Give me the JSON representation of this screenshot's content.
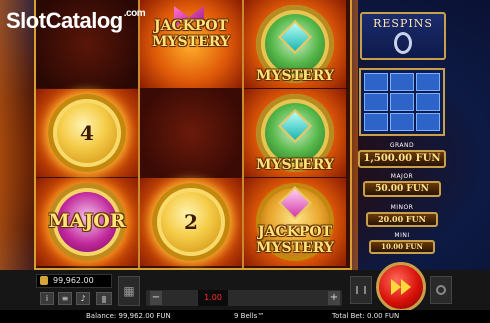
{
  "watermark": {
    "slot": "Slot",
    "catalog": "Catalog",
    "com": ".com"
  },
  "reels": {
    "r1c2": {
      "line1": "JACKPOT",
      "line2": "MYSTERY"
    },
    "r1c3": {
      "label": "MYSTERY"
    },
    "r2c1": {
      "value": "4"
    },
    "r2c3": {
      "label": "MYSTERY"
    },
    "r3c1": {
      "label": "MAJOR"
    },
    "r3c2": {
      "value": "2"
    },
    "r3c3": {
      "line1": "JACKPOT",
      "line2": "MYSTERY"
    }
  },
  "respins": {
    "title": "RESPINS"
  },
  "jackpots": [
    {
      "name": "GRAND",
      "value": "1,500.00 FUN"
    },
    {
      "name": "MAJOR",
      "value": "50.00 FUN"
    },
    {
      "name": "MINOR",
      "value": "20.00 FUN"
    },
    {
      "name": "MINI",
      "value": "10.00 FUN"
    }
  ],
  "balance_box": {
    "value": "99,962.00"
  },
  "bet": {
    "current": "1.00",
    "minus": "−",
    "plus": "+"
  },
  "status": {
    "balance": "Balance: 99,962.00 FUN",
    "game": "9 Bells™",
    "total_bet": "Total Bet: 0.00 FUN"
  },
  "icons": [
    "info-icon",
    "menu-icon",
    "sound-icon",
    "cart-icon",
    "autoplay-icon",
    "spin-icon",
    "turbo-icon"
  ]
}
